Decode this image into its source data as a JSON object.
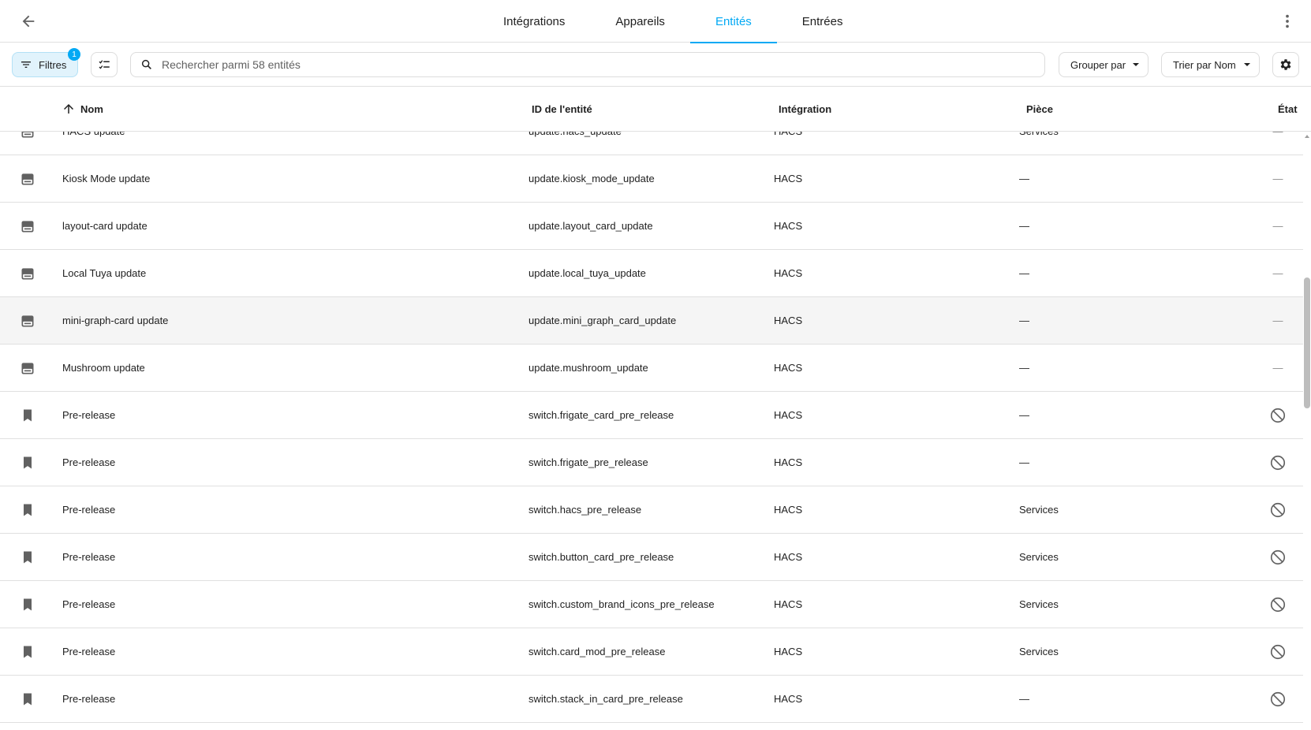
{
  "header": {
    "tabs": [
      {
        "label": "Intégrations"
      },
      {
        "label": "Appareils"
      },
      {
        "label": "Entités"
      },
      {
        "label": "Entrées"
      }
    ],
    "active_tab": "Entités"
  },
  "toolbar": {
    "filter_label": "Filtres",
    "filter_count": "1",
    "search_placeholder": "Rechercher parmi 58 entités",
    "group_label": "Grouper par",
    "sort_label": "Trier par Nom"
  },
  "table": {
    "columns": {
      "name": "Nom",
      "entity_id": "ID de l'entité",
      "integration": "Intégration",
      "area": "Pièce",
      "status": "État"
    },
    "rows": [
      {
        "icon": "package-update-icon",
        "name": "HACS update",
        "entity_id": "update.hacs_update",
        "integration": "HACS",
        "area": "Services",
        "status": "—"
      },
      {
        "icon": "package-update-icon",
        "name": "Kiosk Mode update",
        "entity_id": "update.kiosk_mode_update",
        "integration": "HACS",
        "area": "—",
        "status": "—"
      },
      {
        "icon": "package-update-icon",
        "name": "layout-card update",
        "entity_id": "update.layout_card_update",
        "integration": "HACS",
        "area": "—",
        "status": "—"
      },
      {
        "icon": "package-update-icon",
        "name": "Local Tuya update",
        "entity_id": "update.local_tuya_update",
        "integration": "HACS",
        "area": "—",
        "status": "—"
      },
      {
        "icon": "package-update-icon",
        "name": "mini-graph-card update",
        "entity_id": "update.mini_graph_card_update",
        "integration": "HACS",
        "area": "—",
        "status": "—"
      },
      {
        "icon": "package-update-icon",
        "name": "Mushroom update",
        "entity_id": "update.mushroom_update",
        "integration": "HACS",
        "area": "—",
        "status": "—"
      },
      {
        "icon": "bookmark-icon",
        "name": "Pre-release",
        "entity_id": "switch.frigate_card_pre_release",
        "integration": "HACS",
        "area": "—",
        "status": "disabled-icon"
      },
      {
        "icon": "bookmark-icon",
        "name": "Pre-release",
        "entity_id": "switch.frigate_pre_release",
        "integration": "HACS",
        "area": "—",
        "status": "disabled-icon"
      },
      {
        "icon": "bookmark-icon",
        "name": "Pre-release",
        "entity_id": "switch.hacs_pre_release",
        "integration": "HACS",
        "area": "Services",
        "status": "disabled-icon"
      },
      {
        "icon": "bookmark-icon",
        "name": "Pre-release",
        "entity_id": "switch.button_card_pre_release",
        "integration": "HACS",
        "area": "Services",
        "status": "disabled-icon"
      },
      {
        "icon": "bookmark-icon",
        "name": "Pre-release",
        "entity_id": "switch.custom_brand_icons_pre_release",
        "integration": "HACS",
        "area": "Services",
        "status": "disabled-icon"
      },
      {
        "icon": "bookmark-icon",
        "name": "Pre-release",
        "entity_id": "switch.card_mod_pre_release",
        "integration": "HACS",
        "area": "Services",
        "status": "disabled-icon"
      },
      {
        "icon": "bookmark-icon",
        "name": "Pre-release",
        "entity_id": "switch.stack_in_card_pre_release",
        "integration": "HACS",
        "area": "—",
        "status": "disabled-icon"
      }
    ]
  },
  "colors": {
    "accent": "#03a9f4",
    "hover_row": "#f5f5f5",
    "divider": "#e0e0e0"
  }
}
